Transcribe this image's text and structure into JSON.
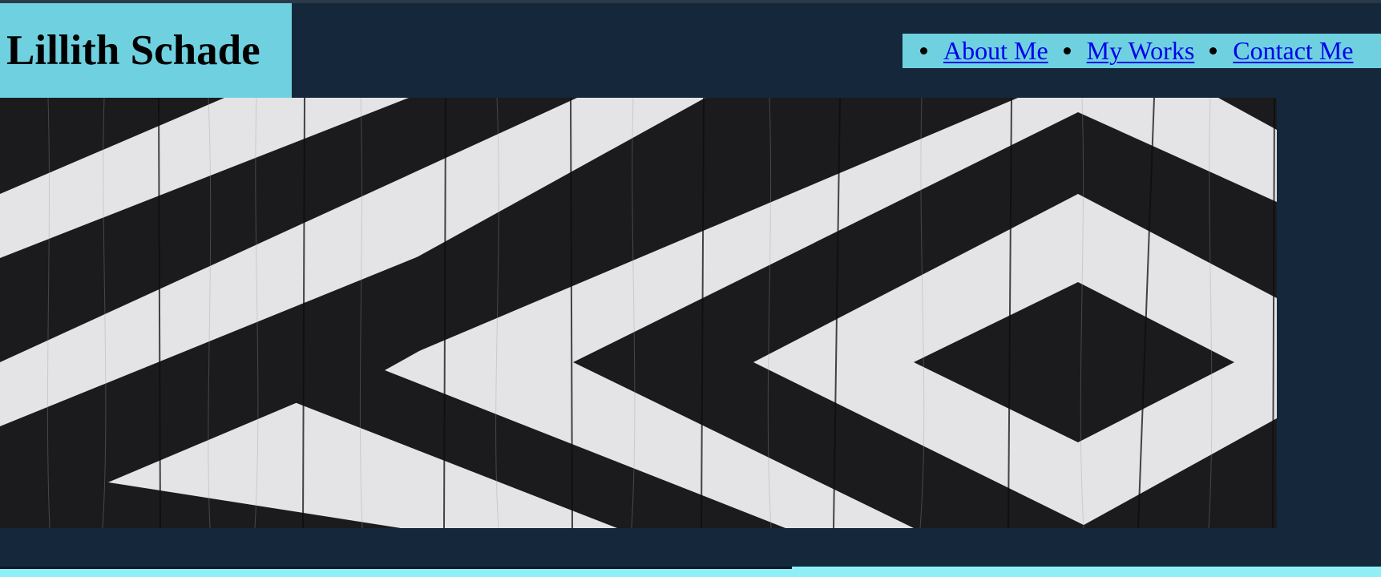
{
  "header": {
    "site_title": "Lillith Schade"
  },
  "nav": {
    "items": [
      {
        "label": "About Me"
      },
      {
        "label": "My Works"
      },
      {
        "label": "Contact Me"
      }
    ]
  },
  "hero": {
    "image_alt": "Black and white geometric chevron pattern painted on wooden planks"
  },
  "colors": {
    "background": "#15283b",
    "accent": "#6fd1df",
    "link": "#0000ee",
    "bottom_bar": "#8eeff6"
  }
}
